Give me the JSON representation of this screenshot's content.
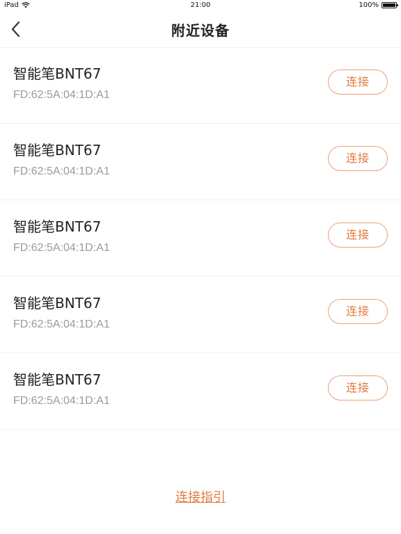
{
  "status_bar": {
    "device": "iPad",
    "time": "21:00",
    "battery_text": "100%",
    "battery_level": 1.0
  },
  "header": {
    "title": "附近设备",
    "back_icon": "chevron-left-icon"
  },
  "devices": [
    {
      "name": "智能笔BNT67",
      "mac": "FD:62:5A:04:1D:A1",
      "action": "连接"
    },
    {
      "name": "智能笔BNT67",
      "mac": "FD:62:5A:04:1D:A1",
      "action": "连接"
    },
    {
      "name": "智能笔BNT67",
      "mac": "FD:62:5A:04:1D:A1",
      "action": "连接"
    },
    {
      "name": "智能笔BNT67",
      "mac": "FD:62:5A:04:1D:A1",
      "action": "连接"
    },
    {
      "name": "智能笔BNT67",
      "mac": "FD:62:5A:04:1D:A1",
      "action": "连接"
    }
  ],
  "footer": {
    "guide_link": "连接指引"
  },
  "colors": {
    "accent": "#e07a3c",
    "accent_border": "#e8a078",
    "text_primary": "#222222",
    "text_secondary": "#9a9a9a"
  }
}
